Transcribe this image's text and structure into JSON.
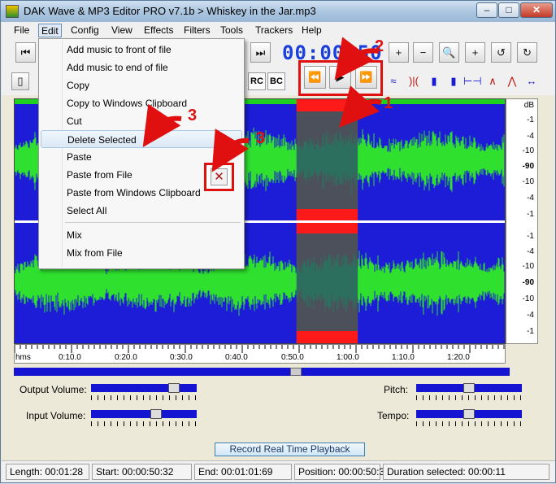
{
  "window": {
    "title": "DAK Wave & MP3 Editor PRO v7.1b > Whiskey in the Jar.mp3",
    "minimize": "–",
    "maximize": "□",
    "close": "✕"
  },
  "menu": [
    "File",
    "Edit",
    "Config",
    "View",
    "Effects",
    "Filters",
    "Tools",
    "Trackers",
    "Help"
  ],
  "toolbar": {
    "time_display": "00:00:50",
    "rc_label": "RC",
    "bc_label": "BC",
    "icons": {
      "skip_start": "⏮",
      "skip_end": "⏭",
      "rewind": "⏪",
      "play": "▶",
      "fast_forward": "⏩",
      "zoom_in": "+",
      "zoom_out": "−",
      "zoom_fit": "🔍",
      "undo": "↺",
      "redo": "↻"
    }
  },
  "edit_menu": {
    "items": [
      "Add music to front of file",
      "Add music to end of file",
      "Copy",
      "Copy to Windows Clipboard",
      "Cut",
      "Delete Selected",
      "Paste",
      "Paste from File",
      "Paste from Windows Clipboard",
      "Select All",
      "Mix",
      "Mix from File"
    ],
    "highlighted": "Delete Selected"
  },
  "annotations": [
    "1",
    "2",
    "3",
    "3"
  ],
  "db_scale": {
    "unit": "dB",
    "channel1": [
      "-1",
      "-4",
      "-10",
      "-90",
      "-10",
      "-4",
      "-1"
    ],
    "channel2": [
      "-1",
      "-4",
      "-10",
      "-90",
      "-10",
      "-4",
      "-1"
    ]
  },
  "time_ruler": {
    "unit": "hms",
    "labels": [
      "0:10.0",
      "0:20.0",
      "0:30.0",
      "0:40.0",
      "0:50.0",
      "1:00.0",
      "1:10.0",
      "1:20.0"
    ]
  },
  "selection": {
    "start_fraction": 0.575,
    "end_fraction": 0.7
  },
  "controls": {
    "output_volume_label": "Output Volume:",
    "input_volume_label": "Input Volume:",
    "pitch_label": "Pitch:",
    "tempo_label": "Tempo:",
    "output_volume_level": 0.82,
    "input_volume_level": 0.63,
    "pitch_level": 0.5,
    "tempo_level": 0.5,
    "scroll_position": 0.57
  },
  "record_button": "Record Real Time Playback",
  "status": {
    "length": "Length: 00:01:28",
    "start": "Start: 00:00:50:32",
    "end": "End: 00:01:01:69",
    "position": "Position: 00:00:50:32",
    "duration": "Duration selected: 00:00:11"
  },
  "colors": {
    "waveform": "#2fe02f",
    "wave_background": "#1d1dd8",
    "selection": "#ff1a1a",
    "annotation": "#e01010",
    "time_display": "#1a3fdb"
  }
}
